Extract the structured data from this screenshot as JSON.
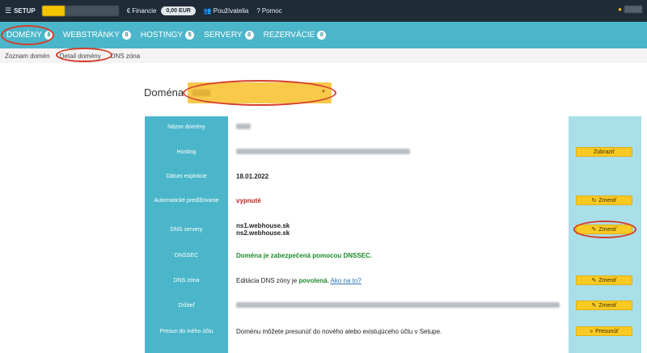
{
  "topbar": {
    "setup_label": "SETUP",
    "financie_label": "Financie",
    "balance": "0,00 EUR",
    "users_label": "Používatelia",
    "help_label": "Pomoc"
  },
  "nav": {
    "tabs": [
      {
        "label": "DOMÉNY",
        "count": "8"
      },
      {
        "label": "WEBSTRÁNKY",
        "count": "0"
      },
      {
        "label": "HOSTINGY",
        "count": "5"
      },
      {
        "label": "SERVERY",
        "count": "0"
      },
      {
        "label": "REZERVÁCIE",
        "count": "0"
      }
    ]
  },
  "subnav": {
    "items": [
      "Zoznam domén",
      "Detail domény",
      "DNS zóna"
    ]
  },
  "domain_selector": {
    "label": "Doména"
  },
  "table": {
    "rows": [
      {
        "label": "Názov domény",
        "value": ""
      },
      {
        "label": "Hosting",
        "value": "",
        "button": "Zobraziť"
      },
      {
        "label": "Dátum expirácie",
        "value": "18.01.2022"
      },
      {
        "label": "Automatické predlžovanie",
        "value": "vypnuté",
        "button": "Zmeniť"
      },
      {
        "label": "DNS servery",
        "value_line1": "ns1.webhouse.sk",
        "value_line2": "ns2.webhouse.sk",
        "button": "Zmeniť"
      },
      {
        "label": "DNSSEC",
        "value": "Doména je zabezpečená pomocou DNSSEC."
      },
      {
        "label": "DNS zóna",
        "value_prefix": "Editácia DNS zóny je",
        "value_strong": "povolená.",
        "value_link": "Ako na to?",
        "button": "Zmeniť"
      },
      {
        "label": "Držiteľ",
        "value": "",
        "button": "Zmeniť"
      },
      {
        "label": "Presun do iného účtu",
        "value": "Doménu môžete presunúť do nového alebo existujúceho účtu v Setupe.",
        "button": "Presunúť"
      }
    ]
  },
  "colors": {
    "topbar_bg": "#1f2c38",
    "nav_bg": "#4bb6c9",
    "accent_yellow": "#f9c924",
    "annotation_red": "#d63b2a",
    "disabled_red": "#c0271d",
    "enabled_green": "#1c8a2a"
  },
  "icons": {
    "setup": "menu-icon",
    "financie": "euro-icon",
    "users": "users-icon",
    "help": "question-icon",
    "user": "user-icon",
    "zobrazit": "none",
    "auto_renew": "refresh-icon",
    "edit": "pencil-icon",
    "move": "double-chevron-icon"
  }
}
